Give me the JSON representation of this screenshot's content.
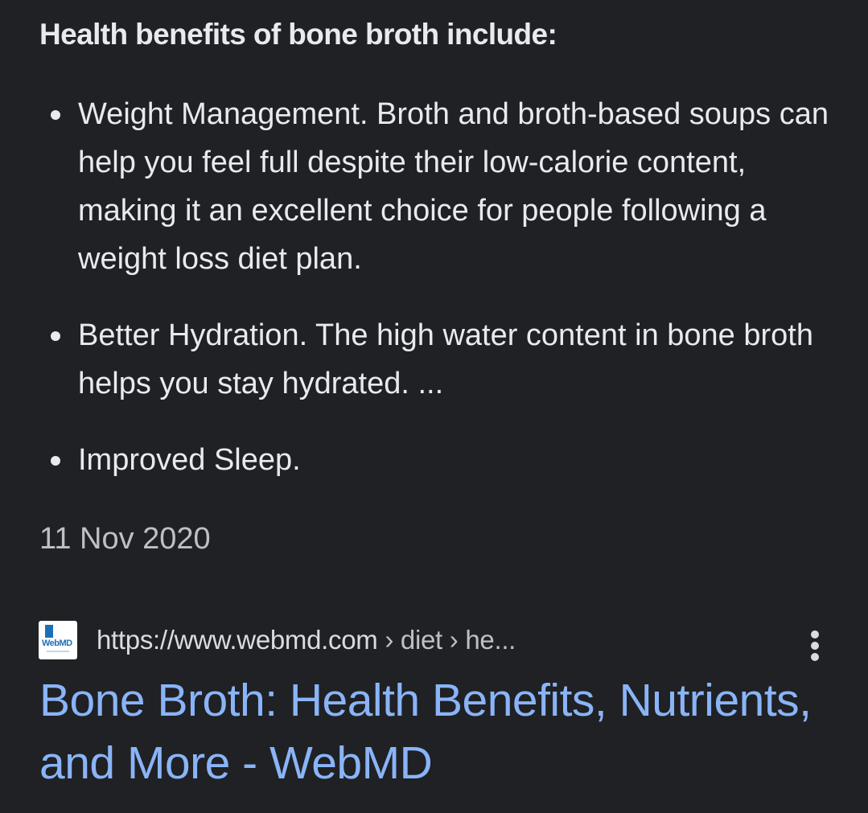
{
  "snippet": {
    "heading": "Health benefits of bone broth include:",
    "bullets": [
      "Weight Management. Broth and broth-based soups can help you feel full despite their low-calorie content, making it an excellent choice for people following a weight loss diet plan.",
      "Better Hydration. The high water content in bone broth helps you stay hydrated. ...",
      "Improved Sleep."
    ],
    "date": "11 Nov 2020"
  },
  "result": {
    "favicon_icon": "webmd-favicon-icon",
    "favicon_text": "WebMD",
    "url_domain": "https://www.webmd.com",
    "url_path": " › diet › he...",
    "menu_icon": "more-vert-icon",
    "title": "Bone Broth: Health Benefits, Nutrients, and More - WebMD"
  },
  "colors": {
    "background": "#202124",
    "text": "#e8eaed",
    "link": "#8ab4f8",
    "secondary": "#bdc1c6"
  }
}
